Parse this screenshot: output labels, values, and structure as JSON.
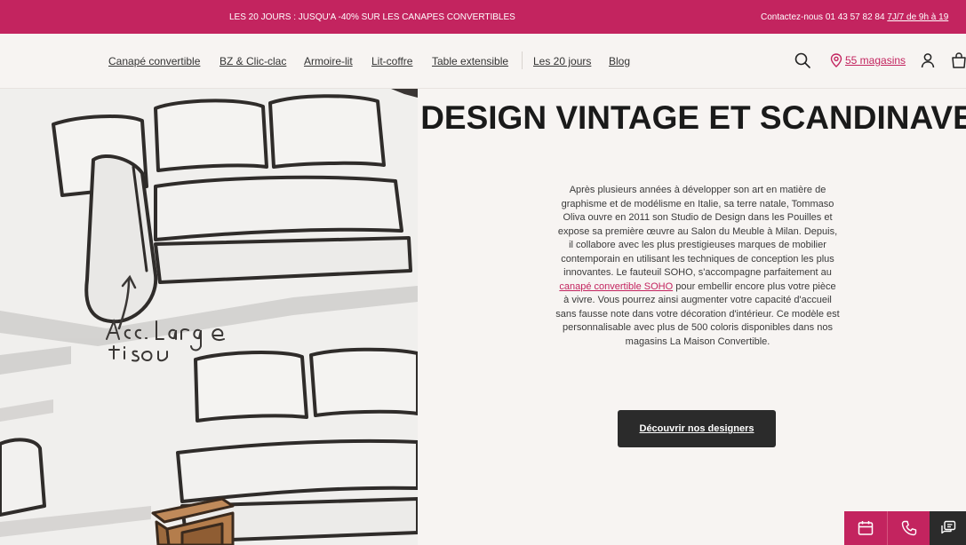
{
  "topbar": {
    "promo": "LES 20 JOURS : JUSQU'A -40% SUR LES CANAPES CONVERTIBLES",
    "contact_prefix": "Contactez-nous 01 43 57 82 84 ",
    "contact_hours": "7J/7 de 9h à 19"
  },
  "nav": {
    "items": [
      {
        "label": "Canapé convertible"
      },
      {
        "label": "BZ & Clic-clac"
      },
      {
        "label": "Armoire-lit"
      },
      {
        "label": "Lit-coffre"
      },
      {
        "label": "Table extensible"
      },
      {
        "label": "Les 20 jours"
      },
      {
        "label": "Blog"
      }
    ],
    "stores_label": "55 magasins",
    "icons": [
      "search-icon",
      "location-pin-icon",
      "user-icon",
      "bag-icon"
    ]
  },
  "hero": {
    "image_alt_text": "",
    "sketch_annotation": "Acc. large tissu"
  },
  "content": {
    "title": "DESIGN VINTAGE ET SCANDINAVE",
    "body_before_link": "Après plusieurs années à développer son art en matière de graphisme et de modélisme en Italie, sa terre natale, Tommaso Oliva ouvre en 2011 son Studio de Design dans les Pouilles et expose sa première œuvre au Salon du Meuble à Milan. Depuis, il collabore avec les plus prestigieuses marques de mobilier contemporain en utilisant les techniques de conception les plus innovantes. Le fauteuil SOHO, s'accompagne parfaitement au ",
    "body_link": "canapé convertible SOHO",
    "body_after_link": " pour embellir encore plus votre pièce à vivre. Vous pourrez ainsi augmenter votre capacité d'accueil sans fausse note dans votre décoration d'intérieur. Ce modèle est personnalisable avec plus de 500 coloris disponibles dans nos magasins La Maison Convertible.",
    "cta_label": "Découvrir nos designers"
  },
  "floating_actions": {
    "icons": [
      "calendar-icon",
      "phone-icon",
      "chat-icon"
    ]
  },
  "colors": {
    "brand": "#c3245f",
    "dark": "#2b2b2b",
    "background": "#f7f4f2"
  }
}
